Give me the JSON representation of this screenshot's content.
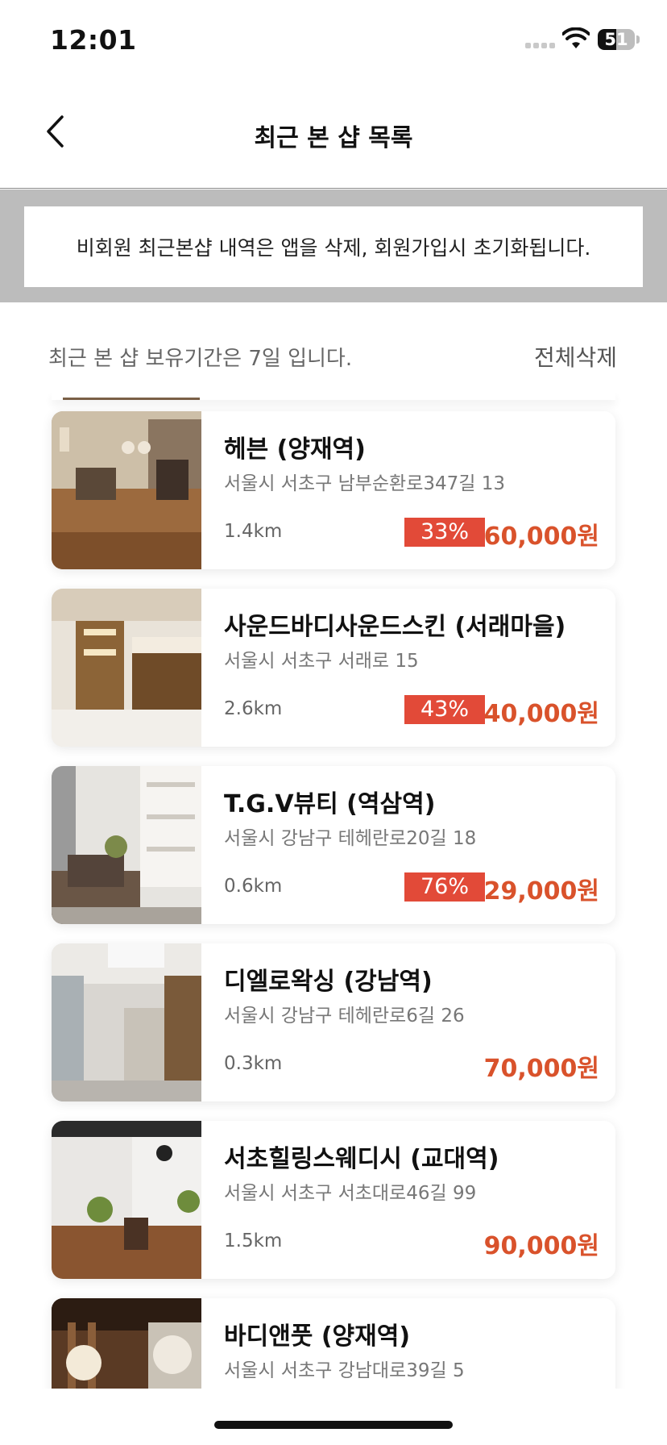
{
  "status": {
    "time": "12:01",
    "battery": "51",
    "battery_level": 0.51
  },
  "nav": {
    "title": "최근 본 샵 목록",
    "back_icon": "chevron-left-icon"
  },
  "notice": {
    "text": "비회원 최근본샵 내역은 앱을 삭제, 회원가입시 초기화됩니다."
  },
  "info": {
    "retention": "최근 본 샵 보유기간은 7일 입니다.",
    "delete_all": "전체삭제"
  },
  "colors": {
    "accent": "#e24a38",
    "price": "#d9522b",
    "notice_band": "#bcbcbc"
  },
  "shops": [
    {
      "name": "헤븐 (양재역)",
      "address": "서울시 서초구 남부순환로347길 13",
      "distance": "1.4km",
      "discount": "33%",
      "price": "60,000원"
    },
    {
      "name": "사운드바디사운드스킨 (서래마을)",
      "address": "서울시 서초구 서래로 15",
      "distance": "2.6km",
      "discount": "43%",
      "price": "40,000원"
    },
    {
      "name": "T.G.V뷰티 (역삼역)",
      "address": "서울시 강남구 테헤란로20길 18",
      "distance": "0.6km",
      "discount": "76%",
      "price": "29,000원"
    },
    {
      "name": "디엘로왁싱 (강남역)",
      "address": "서울시 강남구 테헤란로6길 26",
      "distance": "0.3km",
      "discount": "",
      "price": "70,000원"
    },
    {
      "name": "서초힐링스웨디시 (교대역)",
      "address": "서울시 서초구 서초대로46길 99",
      "distance": "1.5km",
      "discount": "",
      "price": "90,000원"
    },
    {
      "name": "바디앤풋 (양재역)",
      "address": "서울시 서초구 강남대로39길 5",
      "distance": "",
      "discount": "",
      "price": ""
    }
  ]
}
